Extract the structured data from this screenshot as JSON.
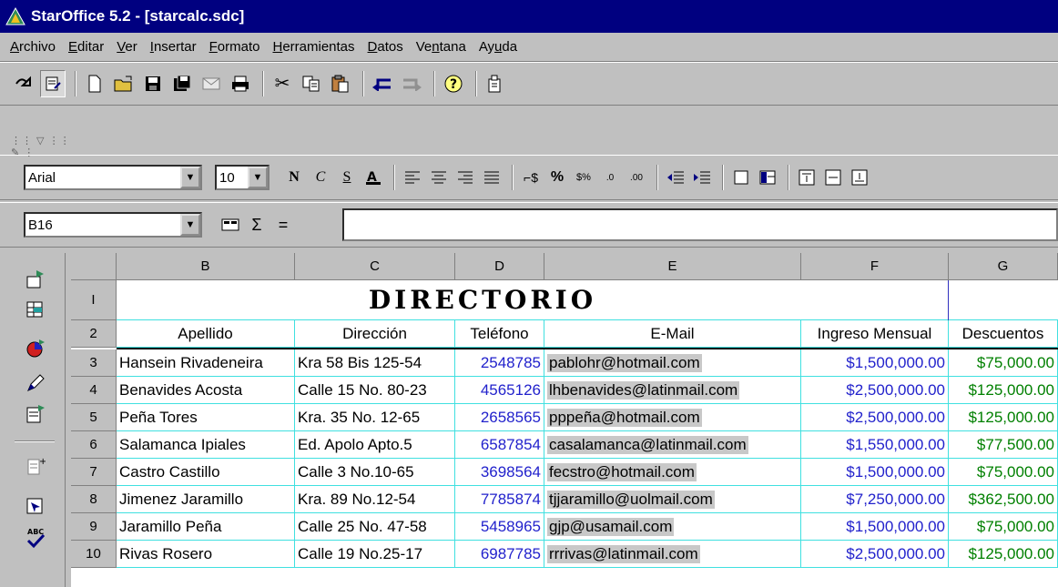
{
  "window": {
    "title": "StarOffice 5.2 - [starcalc.sdc]"
  },
  "menu": [
    "Archivo",
    "Editar",
    "Ver",
    "Insertar",
    "Formato",
    "Herramientas",
    "Datos",
    "Ventana",
    "Ayuda"
  ],
  "menu_underline": [
    "A",
    "E",
    "V",
    "I",
    "F",
    "H",
    "D",
    "n",
    "u"
  ],
  "toolbar_main": [
    {
      "name": "edit-mode-icon",
      "glyph": "⟲"
    },
    {
      "name": "edit-file-icon",
      "glyph": "▤"
    },
    {
      "name": "new-document-icon",
      "glyph": "🗋"
    },
    {
      "name": "open-folder-icon",
      "glyph": "📂"
    },
    {
      "name": "save-icon",
      "glyph": "💾"
    },
    {
      "name": "save-all-icon",
      "glyph": "▣"
    },
    {
      "name": "mail-icon",
      "glyph": "✉"
    },
    {
      "name": "print-icon",
      "glyph": "🖶"
    },
    {
      "name": "cut-icon",
      "glyph": "✂"
    },
    {
      "name": "copy-icon",
      "glyph": "⎘"
    },
    {
      "name": "paste-icon",
      "glyph": "📋"
    },
    {
      "name": "undo-icon",
      "glyph": "↩"
    },
    {
      "name": "redo-icon",
      "glyph": "↪"
    },
    {
      "name": "help-icon",
      "glyph": "?"
    },
    {
      "name": "stylist-icon",
      "glyph": "▦"
    }
  ],
  "format_bar": {
    "font_name": "Arial",
    "font_size": "10",
    "bold": "N",
    "italic": "C",
    "underline": "S"
  },
  "formula_bar": {
    "cell_ref": "B16",
    "sum": "Σ",
    "equals": "=",
    "formula": ""
  },
  "columns": [
    "B",
    "C",
    "D",
    "E",
    "F",
    "G"
  ],
  "rows": [
    {
      "num": "I"
    },
    {
      "num": "2"
    },
    {
      "num": "3"
    },
    {
      "num": "4"
    },
    {
      "num": "5"
    },
    {
      "num": "6"
    },
    {
      "num": "7"
    },
    {
      "num": "8"
    },
    {
      "num": "9"
    },
    {
      "num": "10"
    }
  ],
  "sheet_title": "DIRECTORIO",
  "headers": [
    "Apellido",
    "Dirección",
    "Teléfono",
    "E-Mail",
    "Ingreso Mensual",
    "Descuentos"
  ],
  "records": [
    {
      "apellido": "Hansein Rivadeneira",
      "direccion": "Kra 58 Bis 125-54",
      "telefono": "2548785",
      "email": "pablohr@hotmail.com",
      "ingreso": "$1,500,000.00",
      "descuento": "$75,000.00"
    },
    {
      "apellido": "Benavides Acosta",
      "direccion": "Calle 15 No. 80-23",
      "telefono": "4565126",
      "email": "lhbenavides@latinmail.com",
      "ingreso": "$2,500,000.00",
      "descuento": "$125,000.00"
    },
    {
      "apellido": "Peña Tores",
      "direccion": "Kra. 35 No. 12-65",
      "telefono": "2658565",
      "email": "pppeña@hotmail.com",
      "ingreso": "$2,500,000.00",
      "descuento": "$125,000.00"
    },
    {
      "apellido": "Salamanca Ipiales",
      "direccion": "Ed. Apolo Apto.5",
      "telefono": "6587854",
      "email": "casalamanca@latinmail.com",
      "ingreso": "$1,550,000.00",
      "descuento": "$77,500.00"
    },
    {
      "apellido": "Castro Castillo",
      "direccion": "Calle 3 No.10-65",
      "telefono": "3698564",
      "email": "fecstro@hotmail.com",
      "ingreso": "$1,500,000.00",
      "descuento": "$75,000.00"
    },
    {
      "apellido": "Jimenez Jaramillo",
      "direccion": "Kra. 89 No.12-54",
      "telefono": "7785874",
      "email": "tjjaramillo@uolmail.com",
      "ingreso": "$7,250,000.00",
      "descuento": "$362,500.00"
    },
    {
      "apellido": "Jaramillo Peña",
      "direccion": "Calle 25 No. 47-58",
      "telefono": "5458965",
      "email": "gjp@usamail.com",
      "ingreso": "$1,500,000.00",
      "descuento": "$75,000.00"
    },
    {
      "apellido": "Rivas Rosero",
      "direccion": "Calle 19 No.25-17",
      "telefono": "6987785",
      "email": "rrrivas@latinmail.com",
      "ingreso": "$2,500,000.00",
      "descuento": "$125,000.00"
    }
  ]
}
